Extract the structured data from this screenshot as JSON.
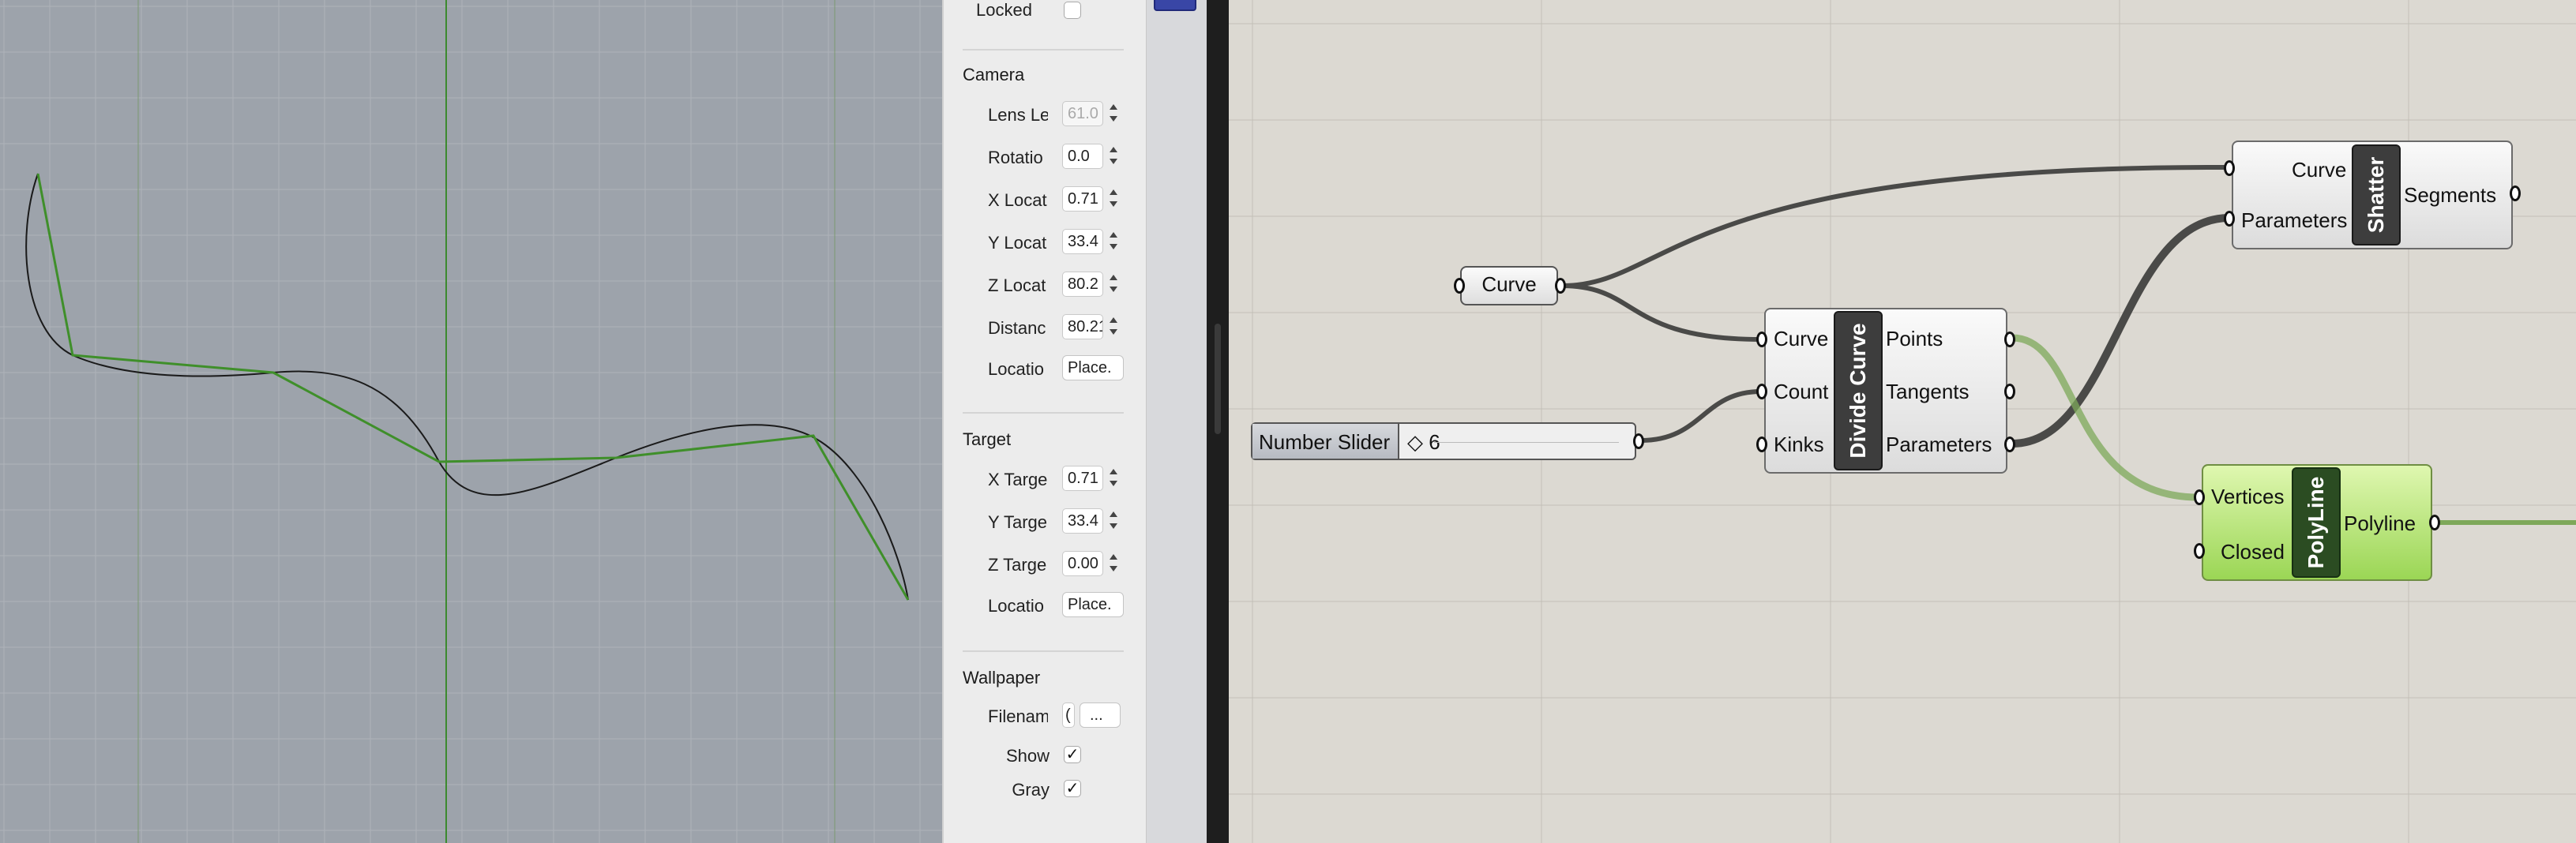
{
  "properties": {
    "locked": {
      "label": "Locked",
      "checked": false
    },
    "camera": {
      "title": "Camera",
      "rows": [
        {
          "label": "Lens Le",
          "value": "61.0",
          "disabled": true
        },
        {
          "label": "Rotatio",
          "value": "0.0"
        },
        {
          "label": "X Locat",
          "value": "0.71"
        },
        {
          "label": "Y Locat",
          "value": "33.4"
        },
        {
          "label": "Z Locat",
          "value": "80.2"
        },
        {
          "label": "Distanc",
          "value": "80.212"
        }
      ],
      "location": {
        "label": "Locatio",
        "button": "Place."
      }
    },
    "target": {
      "title": "Target",
      "rows": [
        {
          "label": "X Targe",
          "value": "0.71"
        },
        {
          "label": "Y Targe",
          "value": "33.4"
        },
        {
          "label": "Z Targe",
          "value": "0.00"
        }
      ],
      "location": {
        "label": "Locatio",
        "button": "Place."
      }
    },
    "wallpaper": {
      "title": "Wallpaper",
      "filename": {
        "label": "Filenam",
        "value": "(",
        "button": "..."
      },
      "show": {
        "label": "Show",
        "checked": true
      },
      "gray": {
        "label": "Gray",
        "checked": true
      }
    }
  },
  "canvas": {
    "curve_param": {
      "label": "Curve"
    },
    "slider": {
      "name": "Number Slider",
      "value": "6"
    },
    "divide_curve": {
      "nickname": "Divide Curve",
      "inputs": [
        "Curve",
        "Count",
        "Kinks"
      ],
      "outputs": [
        "Points",
        "Tangents",
        "Parameters"
      ]
    },
    "shatter": {
      "nickname": "Shatter",
      "inputs": [
        "Curve",
        "Parameters"
      ],
      "outputs": [
        "Segments"
      ]
    },
    "polyline": {
      "nickname": "PolyLine",
      "inputs": [
        "Vertices",
        "Closed"
      ],
      "outputs": [
        "Polyline"
      ]
    }
  },
  "colors": {
    "viewport_bg": "#9da3ab",
    "grid_axis_green": "#3c8a2e",
    "polyline_green": "#3f8f2a",
    "wire_dark": "#4a4a48",
    "wire_green": "#7ea85a",
    "component_green": "#a9de66"
  }
}
